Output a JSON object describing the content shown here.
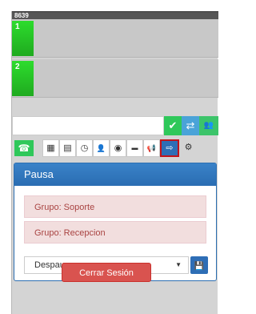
{
  "topbar": {
    "extension": "8639"
  },
  "lines": [
    {
      "label": "1"
    },
    {
      "label": "2"
    }
  ],
  "input_row": {
    "placeholder": "",
    "buttons": [
      {
        "icon": "check-icon",
        "glyph": "✔"
      },
      {
        "icon": "transfer-icon",
        "glyph": "⇄"
      },
      {
        "icon": "conference-icon",
        "glyph": "👥"
      }
    ]
  },
  "toolbar": {
    "phone_glyph": "☎",
    "buttons": [
      {
        "name": "dialpad-icon",
        "glyph": "▦"
      },
      {
        "name": "calculator-icon",
        "glyph": "▤"
      },
      {
        "name": "clock-icon",
        "glyph": "◷"
      },
      {
        "name": "user-icon",
        "glyph": "👤"
      },
      {
        "name": "globe-icon",
        "glyph": "◉"
      },
      {
        "name": "chat-icon",
        "glyph": "▬"
      },
      {
        "name": "megaphone-icon",
        "glyph": "📢"
      },
      {
        "name": "pause-exit-icon",
        "glyph": "⇨"
      },
      {
        "name": "settings-icon",
        "glyph": "⚙"
      }
    ]
  },
  "panel": {
    "title": "Pausa",
    "groups": [
      "Grupo: Soporte",
      "Grupo: Recepcion"
    ],
    "select": {
      "value": "Despausar",
      "caret": "▼"
    },
    "save_glyph": "💾"
  },
  "logout": {
    "label": "Cerrar Sesión"
  },
  "colors": {
    "accent_blue": "#2e6eb6",
    "green": "#2fc85a",
    "danger": "#d9534f"
  }
}
